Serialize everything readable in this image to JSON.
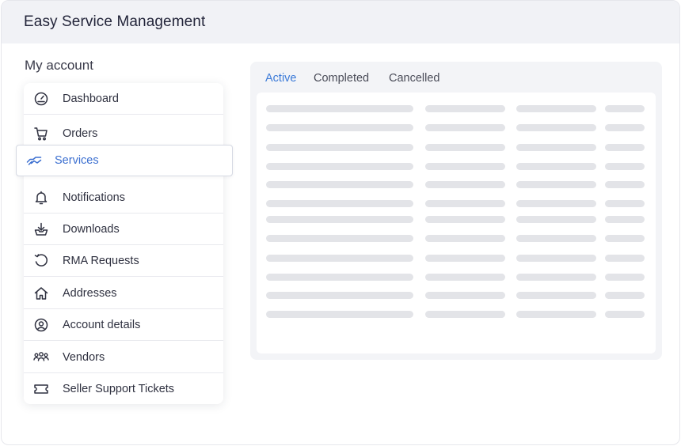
{
  "app": {
    "title": "Easy Service Management"
  },
  "account": {
    "heading": "My account",
    "menu": [
      {
        "label": "Dashboard",
        "icon": "gauge-icon"
      },
      {
        "label": "Orders",
        "icon": "cart-icon"
      },
      {
        "label": "Services",
        "icon": "handshake-icon",
        "active": true
      },
      {
        "label": "Notifications",
        "icon": "bell-icon"
      },
      {
        "label": "Downloads",
        "icon": "download-tray-icon"
      },
      {
        "label": "RMA Requests",
        "icon": "undo-arrow-icon"
      },
      {
        "label": "Addresses",
        "icon": "home-icon"
      },
      {
        "label": "Account details",
        "icon": "user-circle-icon"
      },
      {
        "label": "Vendors",
        "icon": "users-group-icon"
      },
      {
        "label": "Seller Support Tickets",
        "icon": "ticket-icon"
      }
    ]
  },
  "services": {
    "tabs": [
      {
        "label": "Active",
        "active": true
      },
      {
        "label": "Completed"
      },
      {
        "label": "Cancelled"
      }
    ],
    "loading_rows": 12
  },
  "colors": {
    "accent": "#3b7ad8",
    "header_bg": "#f1f2f6",
    "skeleton": "#e3e4e8"
  }
}
